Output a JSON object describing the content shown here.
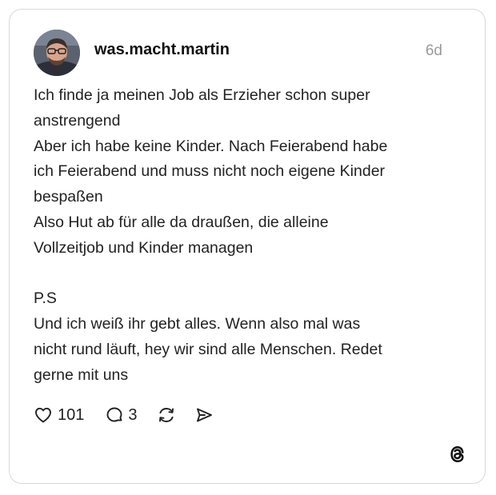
{
  "post": {
    "username": "was.macht.martin",
    "time": "6d",
    "paragraphs": [
      [
        "Ich finde ja meinen Job als Erzieher schon super",
        "anstrengend"
      ],
      [
        "Aber ich habe keine Kinder. Nach Feierabend habe",
        "ich Feierabend und muss nicht noch eigene Kinder",
        "bespaßen"
      ],
      [
        "Also Hut ab für alle da draußen, die alleine",
        "Vollzeitjob und Kinder managen"
      ],
      [],
      [
        "P.S"
      ],
      [
        "Und ich weiß ihr gebt alles. Wenn also mal was",
        "nicht rund läuft, hey wir sind alle Menschen. Redet",
        "gerne mit uns"
      ]
    ]
  },
  "actions": {
    "like_icon": "heart-icon",
    "like_count": "101",
    "reply_icon": "comment-bubble-icon",
    "reply_count": "3",
    "repost_icon": "repost-icon",
    "share_icon": "send-icon"
  },
  "branding": {
    "logo_icon": "threads-logo-icon"
  }
}
